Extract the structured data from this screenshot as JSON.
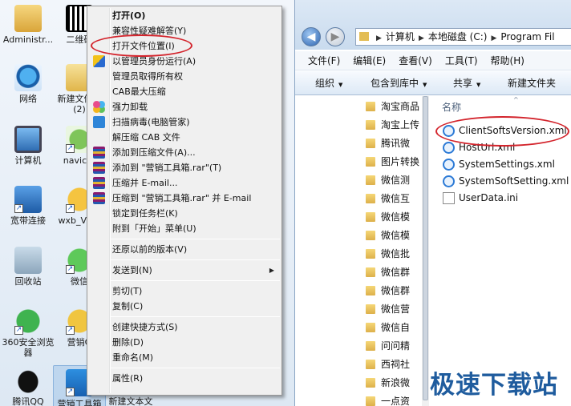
{
  "desktop": {
    "icons": [
      {
        "label": "Administr..."
      },
      {
        "label": "二维码"
      },
      {
        "label": "网络"
      },
      {
        "label": "新建文件夹"
      },
      {
        "label": "(2)"
      },
      {
        "label": "计算机"
      },
      {
        "label": "navicat"
      },
      {
        "label": "宽带连接"
      },
      {
        "label": "wxb_V1..."
      },
      {
        "label": "回收站"
      },
      {
        "label": "微信"
      },
      {
        "label": "360安全浏览"
      },
      {
        "label": "器"
      },
      {
        "label": "营销Q"
      },
      {
        "label": "腾讯QQ"
      },
      {
        "label": "营销工具箱"
      },
      {
        "label": "新建文本文"
      }
    ]
  },
  "context_menu": {
    "items": [
      {
        "label": "打开(O)"
      },
      {
        "label": "兼容性疑难解答(Y)"
      },
      {
        "label": "打开文件位置(I)"
      },
      {
        "label": "以管理员身份运行(A)"
      },
      {
        "label": "管理员取得所有权"
      },
      {
        "label": "CAB最大压缩"
      },
      {
        "label": "强力卸载"
      },
      {
        "label": "扫描病毒(电脑管家)"
      },
      {
        "label": "解压缩 CAB 文件"
      },
      {
        "label": "添加到压缩文件(A)..."
      },
      {
        "label": "添加到 \"营销工具箱.rar\"(T)"
      },
      {
        "label": "压缩并 E-mail..."
      },
      {
        "label": "压缩到 \"营销工具箱.rar\" 并 E-mail"
      },
      {
        "label": "锁定到任务栏(K)"
      },
      {
        "label": "附到「开始」菜单(U)"
      },
      {
        "label": "还原以前的版本(V)"
      },
      {
        "label": "发送到(N)"
      },
      {
        "label": "剪切(T)"
      },
      {
        "label": "复制(C)"
      },
      {
        "label": "创建快捷方式(S)"
      },
      {
        "label": "删除(D)"
      },
      {
        "label": "重命名(M)"
      },
      {
        "label": "属性(R)"
      }
    ]
  },
  "explorer": {
    "breadcrumb": [
      "计算机",
      "本地磁盘 (C:)",
      "Program Fil"
    ],
    "menubar": [
      "文件(F)",
      "编辑(E)",
      "查看(V)",
      "工具(T)",
      "帮助(H)"
    ],
    "toolbar": {
      "organize": "组织",
      "include": "包含到库中",
      "share": "共享",
      "new_folder": "新建文件夹"
    },
    "nav_folders": [
      "淘宝商品",
      "淘宝上传",
      "腾讯微",
      "图片转换",
      "微信测",
      "微信互",
      "微信模",
      "微信模",
      "微信批",
      "微信群",
      "微信群",
      "微信营",
      "微信自",
      "问问精",
      "西祠社",
      "新浪微",
      "一点资"
    ],
    "column_header": "名称",
    "files": [
      {
        "name": "ClientSoftsVersion.xml",
        "icon": "ie-xml-icon"
      },
      {
        "name": "HostUrl.xml",
        "icon": "ie-xml-icon"
      },
      {
        "name": "SystemSettings.xml",
        "icon": "ie-xml-icon"
      },
      {
        "name": "SystemSoftSetting.xml",
        "icon": "ie-xml-icon"
      },
      {
        "name": "UserData.ini",
        "icon": "ini-file-icon"
      }
    ]
  },
  "watermark": "极速下载站",
  "colors": {
    "highlight_oval": "#d3242c",
    "watermark": "#1f5c9e"
  }
}
